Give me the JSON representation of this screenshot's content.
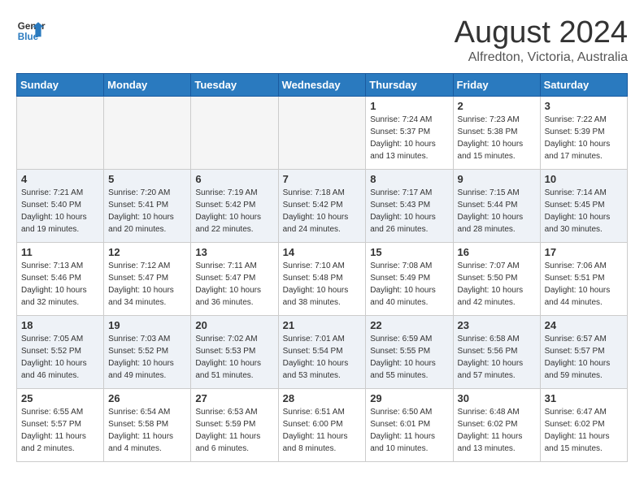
{
  "header": {
    "logo_line1": "General",
    "logo_line2": "Blue",
    "month": "August 2024",
    "location": "Alfredton, Victoria, Australia"
  },
  "weekdays": [
    "Sunday",
    "Monday",
    "Tuesday",
    "Wednesday",
    "Thursday",
    "Friday",
    "Saturday"
  ],
  "weeks": [
    [
      {
        "day": "",
        "info": ""
      },
      {
        "day": "",
        "info": ""
      },
      {
        "day": "",
        "info": ""
      },
      {
        "day": "",
        "info": ""
      },
      {
        "day": "1",
        "info": "Sunrise: 7:24 AM\nSunset: 5:37 PM\nDaylight: 10 hours\nand 13 minutes."
      },
      {
        "day": "2",
        "info": "Sunrise: 7:23 AM\nSunset: 5:38 PM\nDaylight: 10 hours\nand 15 minutes."
      },
      {
        "day": "3",
        "info": "Sunrise: 7:22 AM\nSunset: 5:39 PM\nDaylight: 10 hours\nand 17 minutes."
      }
    ],
    [
      {
        "day": "4",
        "info": "Sunrise: 7:21 AM\nSunset: 5:40 PM\nDaylight: 10 hours\nand 19 minutes."
      },
      {
        "day": "5",
        "info": "Sunrise: 7:20 AM\nSunset: 5:41 PM\nDaylight: 10 hours\nand 20 minutes."
      },
      {
        "day": "6",
        "info": "Sunrise: 7:19 AM\nSunset: 5:42 PM\nDaylight: 10 hours\nand 22 minutes."
      },
      {
        "day": "7",
        "info": "Sunrise: 7:18 AM\nSunset: 5:42 PM\nDaylight: 10 hours\nand 24 minutes."
      },
      {
        "day": "8",
        "info": "Sunrise: 7:17 AM\nSunset: 5:43 PM\nDaylight: 10 hours\nand 26 minutes."
      },
      {
        "day": "9",
        "info": "Sunrise: 7:15 AM\nSunset: 5:44 PM\nDaylight: 10 hours\nand 28 minutes."
      },
      {
        "day": "10",
        "info": "Sunrise: 7:14 AM\nSunset: 5:45 PM\nDaylight: 10 hours\nand 30 minutes."
      }
    ],
    [
      {
        "day": "11",
        "info": "Sunrise: 7:13 AM\nSunset: 5:46 PM\nDaylight: 10 hours\nand 32 minutes."
      },
      {
        "day": "12",
        "info": "Sunrise: 7:12 AM\nSunset: 5:47 PM\nDaylight: 10 hours\nand 34 minutes."
      },
      {
        "day": "13",
        "info": "Sunrise: 7:11 AM\nSunset: 5:47 PM\nDaylight: 10 hours\nand 36 minutes."
      },
      {
        "day": "14",
        "info": "Sunrise: 7:10 AM\nSunset: 5:48 PM\nDaylight: 10 hours\nand 38 minutes."
      },
      {
        "day": "15",
        "info": "Sunrise: 7:08 AM\nSunset: 5:49 PM\nDaylight: 10 hours\nand 40 minutes."
      },
      {
        "day": "16",
        "info": "Sunrise: 7:07 AM\nSunset: 5:50 PM\nDaylight: 10 hours\nand 42 minutes."
      },
      {
        "day": "17",
        "info": "Sunrise: 7:06 AM\nSunset: 5:51 PM\nDaylight: 10 hours\nand 44 minutes."
      }
    ],
    [
      {
        "day": "18",
        "info": "Sunrise: 7:05 AM\nSunset: 5:52 PM\nDaylight: 10 hours\nand 46 minutes."
      },
      {
        "day": "19",
        "info": "Sunrise: 7:03 AM\nSunset: 5:52 PM\nDaylight: 10 hours\nand 49 minutes."
      },
      {
        "day": "20",
        "info": "Sunrise: 7:02 AM\nSunset: 5:53 PM\nDaylight: 10 hours\nand 51 minutes."
      },
      {
        "day": "21",
        "info": "Sunrise: 7:01 AM\nSunset: 5:54 PM\nDaylight: 10 hours\nand 53 minutes."
      },
      {
        "day": "22",
        "info": "Sunrise: 6:59 AM\nSunset: 5:55 PM\nDaylight: 10 hours\nand 55 minutes."
      },
      {
        "day": "23",
        "info": "Sunrise: 6:58 AM\nSunset: 5:56 PM\nDaylight: 10 hours\nand 57 minutes."
      },
      {
        "day": "24",
        "info": "Sunrise: 6:57 AM\nSunset: 5:57 PM\nDaylight: 10 hours\nand 59 minutes."
      }
    ],
    [
      {
        "day": "25",
        "info": "Sunrise: 6:55 AM\nSunset: 5:57 PM\nDaylight: 11 hours\nand 2 minutes."
      },
      {
        "day": "26",
        "info": "Sunrise: 6:54 AM\nSunset: 5:58 PM\nDaylight: 11 hours\nand 4 minutes."
      },
      {
        "day": "27",
        "info": "Sunrise: 6:53 AM\nSunset: 5:59 PM\nDaylight: 11 hours\nand 6 minutes."
      },
      {
        "day": "28",
        "info": "Sunrise: 6:51 AM\nSunset: 6:00 PM\nDaylight: 11 hours\nand 8 minutes."
      },
      {
        "day": "29",
        "info": "Sunrise: 6:50 AM\nSunset: 6:01 PM\nDaylight: 11 hours\nand 10 minutes."
      },
      {
        "day": "30",
        "info": "Sunrise: 6:48 AM\nSunset: 6:02 PM\nDaylight: 11 hours\nand 13 minutes."
      },
      {
        "day": "31",
        "info": "Sunrise: 6:47 AM\nSunset: 6:02 PM\nDaylight: 11 hours\nand 15 minutes."
      }
    ]
  ]
}
